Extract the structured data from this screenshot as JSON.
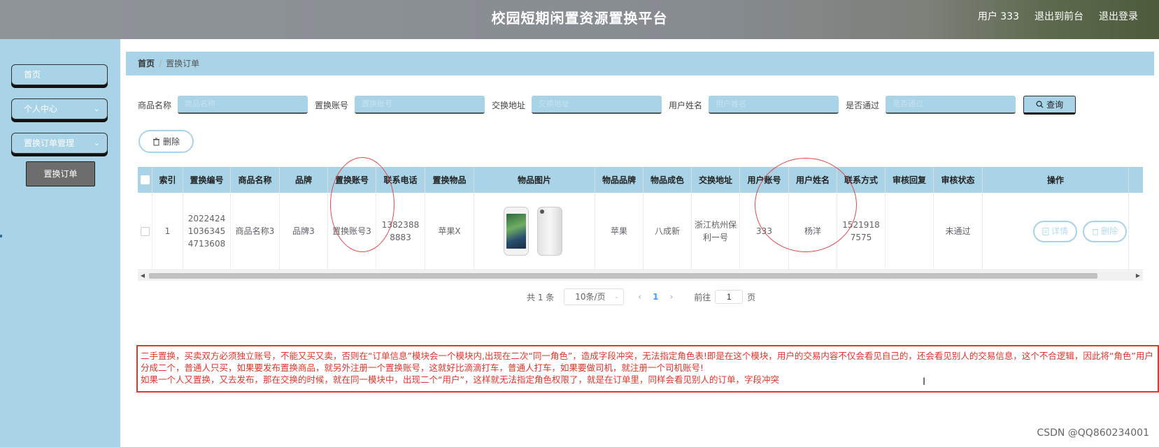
{
  "header": {
    "title": "校园短期闲置资源置换平台",
    "user_label": "用户 333",
    "front_label": "退出到前台",
    "logout_label": "退出登录"
  },
  "sidebar": {
    "items": [
      {
        "label": "首页"
      },
      {
        "label": "个人中心",
        "chevron": "chevron-down-icon"
      },
      {
        "label": "置换订单管理",
        "chevron": "chevron-down-icon"
      }
    ],
    "subitem": "置换订单"
  },
  "breadcrumb": {
    "home": "首页",
    "separator": "/",
    "current": "置换订单"
  },
  "search": {
    "fields": [
      {
        "label": "商品名称",
        "placeholder": "商品名称"
      },
      {
        "label": "置换账号",
        "placeholder": "置换账号"
      },
      {
        "label": "交换地址",
        "placeholder": "交换地址"
      },
      {
        "label": "用户姓名",
        "placeholder": "用户姓名"
      },
      {
        "label": "是否通过",
        "placeholder": "是否通过"
      }
    ],
    "query_label": "查询"
  },
  "toolbar": {
    "delete_label": "删除"
  },
  "table": {
    "headers": [
      "索引",
      "置换编号",
      "商品名称",
      "品牌",
      "置换账号",
      "联系电话",
      "置换物品",
      "物品图片",
      "物品品牌",
      "物品成色",
      "交换地址",
      "用户账号",
      "用户姓名",
      "联系方式",
      "审核回复",
      "审核状态",
      "操作"
    ],
    "rows": [
      {
        "index": "1",
        "order_no": "20224241036345 4713608",
        "product_name": "商品名称3",
        "brand": "品牌3",
        "swap_account": "置换账号3",
        "phone": "13823888883",
        "swap_item": "苹果X",
        "item_brand": "苹果",
        "condition": "八成新",
        "address": "浙江杭州保利一号",
        "user_account": "333",
        "user_name": "杨洋",
        "contact": "15219187575",
        "review_reply": "",
        "review_status": "未通过",
        "detail_label": "详情",
        "delete_label": "删除"
      }
    ]
  },
  "pagination": {
    "total": "共 1 条",
    "page_size": "10条/页",
    "current_page": "1",
    "goto_label": "前往",
    "goto_value": "1",
    "page_word": "页"
  },
  "note": {
    "lines": [
      "二手置换，买卖双方必须独立账号，不能又买又卖，否则在“订单信息”模块会一个模块内,出现在二次“同一角色”，造成字段冲突，无法指定角色表!即是在这个模块，用户的交易内容不仅会看见自己的，还会看见别人的交易信息，这个不合逻辑，因此将“角色”用户分成二个，普通人只买，如果要发布置换商品，就另外注册一个置换账号，这就好比滴滴打车，普通人打车，如果要做司机，就注册一个司机账号!",
      "如果一个人又置换，又去发布，那在交换的时候，就在同一模块中，出现二个“用户”，这样就无法指定角色权限了，就是在订单里，同样会看见别人的订单，字段冲突"
    ]
  },
  "watermark": "CSDN @QQ860234001",
  "colors": {
    "accent": "#a9d3e6",
    "annotation": "#e0352b"
  }
}
